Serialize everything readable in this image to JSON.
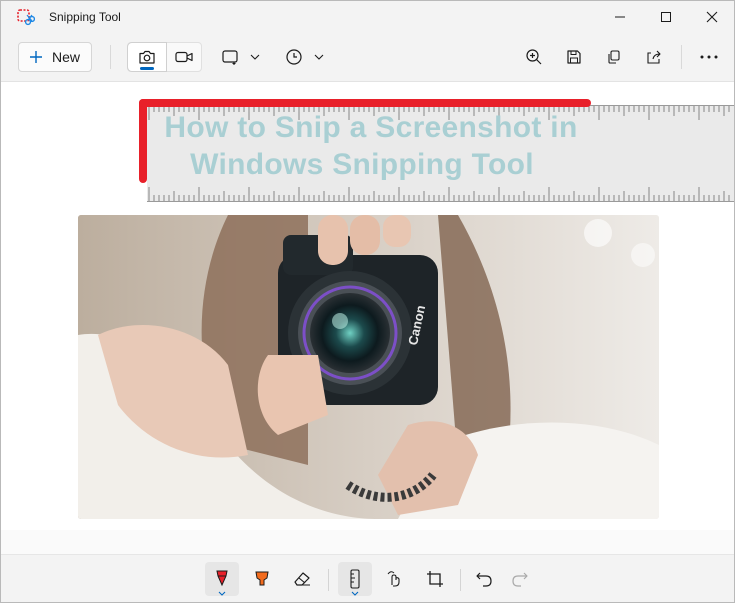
{
  "window": {
    "title": "Snipping Tool"
  },
  "toolbar": {
    "new_label": "New",
    "icons": [
      "plus-icon",
      "camera-icon",
      "video-icon",
      "rectangle-snip-icon",
      "chevron-down-icon",
      "clock-icon",
      "zoom-in-icon",
      "save-icon",
      "copy-icon",
      "share-icon",
      "more-icon"
    ]
  },
  "canvas": {
    "headline_line1": "How to Snip a Screenshot in",
    "headline_line2": "Windows Snipping Tool",
    "photo_label": "Canon",
    "accent_color": "#e8202a",
    "headline_color": "#a9cfd3"
  },
  "bottom_toolbar": {
    "icons": [
      "ballpoint-pen-icon",
      "highlighter-icon",
      "eraser-icon",
      "ruler-icon",
      "touch-writing-icon",
      "crop-icon",
      "undo-icon",
      "redo-icon"
    ]
  },
  "colors": {
    "accent": "#0067c0",
    "pen": "#e8202a",
    "highlighter": "#f26b1d"
  }
}
